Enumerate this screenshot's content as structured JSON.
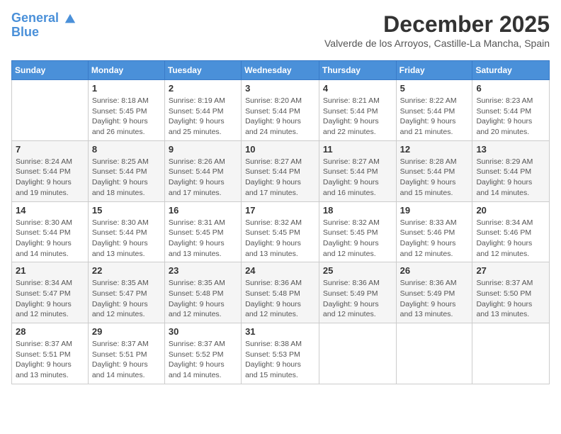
{
  "header": {
    "logo_line1": "General",
    "logo_line2": "Blue",
    "title": "December 2025",
    "subtitle": "Valverde de los Arroyos, Castille-La Mancha, Spain"
  },
  "days_of_week": [
    "Sunday",
    "Monday",
    "Tuesday",
    "Wednesday",
    "Thursday",
    "Friday",
    "Saturday"
  ],
  "weeks": [
    [
      {
        "day": "",
        "info": ""
      },
      {
        "day": "1",
        "info": "Sunrise: 8:18 AM\nSunset: 5:45 PM\nDaylight: 9 hours\nand 26 minutes."
      },
      {
        "day": "2",
        "info": "Sunrise: 8:19 AM\nSunset: 5:44 PM\nDaylight: 9 hours\nand 25 minutes."
      },
      {
        "day": "3",
        "info": "Sunrise: 8:20 AM\nSunset: 5:44 PM\nDaylight: 9 hours\nand 24 minutes."
      },
      {
        "day": "4",
        "info": "Sunrise: 8:21 AM\nSunset: 5:44 PM\nDaylight: 9 hours\nand 22 minutes."
      },
      {
        "day": "5",
        "info": "Sunrise: 8:22 AM\nSunset: 5:44 PM\nDaylight: 9 hours\nand 21 minutes."
      },
      {
        "day": "6",
        "info": "Sunrise: 8:23 AM\nSunset: 5:44 PM\nDaylight: 9 hours\nand 20 minutes."
      }
    ],
    [
      {
        "day": "7",
        "info": "Sunrise: 8:24 AM\nSunset: 5:44 PM\nDaylight: 9 hours\nand 19 minutes."
      },
      {
        "day": "8",
        "info": "Sunrise: 8:25 AM\nSunset: 5:44 PM\nDaylight: 9 hours\nand 18 minutes."
      },
      {
        "day": "9",
        "info": "Sunrise: 8:26 AM\nSunset: 5:44 PM\nDaylight: 9 hours\nand 17 minutes."
      },
      {
        "day": "10",
        "info": "Sunrise: 8:27 AM\nSunset: 5:44 PM\nDaylight: 9 hours\nand 17 minutes."
      },
      {
        "day": "11",
        "info": "Sunrise: 8:27 AM\nSunset: 5:44 PM\nDaylight: 9 hours\nand 16 minutes."
      },
      {
        "day": "12",
        "info": "Sunrise: 8:28 AM\nSunset: 5:44 PM\nDaylight: 9 hours\nand 15 minutes."
      },
      {
        "day": "13",
        "info": "Sunrise: 8:29 AM\nSunset: 5:44 PM\nDaylight: 9 hours\nand 14 minutes."
      }
    ],
    [
      {
        "day": "14",
        "info": "Sunrise: 8:30 AM\nSunset: 5:44 PM\nDaylight: 9 hours\nand 14 minutes."
      },
      {
        "day": "15",
        "info": "Sunrise: 8:30 AM\nSunset: 5:44 PM\nDaylight: 9 hours\nand 13 minutes."
      },
      {
        "day": "16",
        "info": "Sunrise: 8:31 AM\nSunset: 5:45 PM\nDaylight: 9 hours\nand 13 minutes."
      },
      {
        "day": "17",
        "info": "Sunrise: 8:32 AM\nSunset: 5:45 PM\nDaylight: 9 hours\nand 13 minutes."
      },
      {
        "day": "18",
        "info": "Sunrise: 8:32 AM\nSunset: 5:45 PM\nDaylight: 9 hours\nand 12 minutes."
      },
      {
        "day": "19",
        "info": "Sunrise: 8:33 AM\nSunset: 5:46 PM\nDaylight: 9 hours\nand 12 minutes."
      },
      {
        "day": "20",
        "info": "Sunrise: 8:34 AM\nSunset: 5:46 PM\nDaylight: 9 hours\nand 12 minutes."
      }
    ],
    [
      {
        "day": "21",
        "info": "Sunrise: 8:34 AM\nSunset: 5:47 PM\nDaylight: 9 hours\nand 12 minutes."
      },
      {
        "day": "22",
        "info": "Sunrise: 8:35 AM\nSunset: 5:47 PM\nDaylight: 9 hours\nand 12 minutes."
      },
      {
        "day": "23",
        "info": "Sunrise: 8:35 AM\nSunset: 5:48 PM\nDaylight: 9 hours\nand 12 minutes."
      },
      {
        "day": "24",
        "info": "Sunrise: 8:36 AM\nSunset: 5:48 PM\nDaylight: 9 hours\nand 12 minutes."
      },
      {
        "day": "25",
        "info": "Sunrise: 8:36 AM\nSunset: 5:49 PM\nDaylight: 9 hours\nand 12 minutes."
      },
      {
        "day": "26",
        "info": "Sunrise: 8:36 AM\nSunset: 5:49 PM\nDaylight: 9 hours\nand 13 minutes."
      },
      {
        "day": "27",
        "info": "Sunrise: 8:37 AM\nSunset: 5:50 PM\nDaylight: 9 hours\nand 13 minutes."
      }
    ],
    [
      {
        "day": "28",
        "info": "Sunrise: 8:37 AM\nSunset: 5:51 PM\nDaylight: 9 hours\nand 13 minutes."
      },
      {
        "day": "29",
        "info": "Sunrise: 8:37 AM\nSunset: 5:51 PM\nDaylight: 9 hours\nand 14 minutes."
      },
      {
        "day": "30",
        "info": "Sunrise: 8:37 AM\nSunset: 5:52 PM\nDaylight: 9 hours\nand 14 minutes."
      },
      {
        "day": "31",
        "info": "Sunrise: 8:38 AM\nSunset: 5:53 PM\nDaylight: 9 hours\nand 15 minutes."
      },
      {
        "day": "",
        "info": ""
      },
      {
        "day": "",
        "info": ""
      },
      {
        "day": "",
        "info": ""
      }
    ]
  ]
}
